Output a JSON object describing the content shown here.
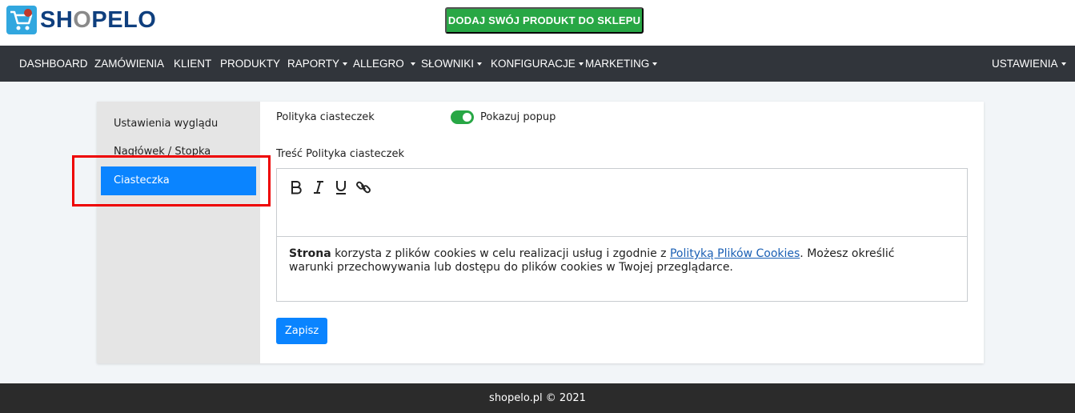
{
  "header": {
    "logo": {
      "prefix": "SH",
      "o": "O",
      "suffix": "PELO"
    },
    "cta_label": "DODAJ SWÓJ PRODUKT DO SKLEPU"
  },
  "nav": {
    "items": [
      {
        "label": "DASHBOARD"
      },
      {
        "label": "ZAMÓWIENIA"
      },
      {
        "label": "KLIENT"
      },
      {
        "label": "PRODUKTY"
      },
      {
        "label": "RAPORTY"
      },
      {
        "label": "ALLEGRO"
      },
      {
        "label": "SŁOWNIKI"
      },
      {
        "label": "KONFIGURACJE"
      },
      {
        "label": "MARKETING"
      }
    ],
    "settings_label": "USTAWIENIA"
  },
  "sidebar": {
    "items": [
      {
        "label": "Ustawienia wyglądu"
      },
      {
        "label": "Nagłówek / Stopka"
      },
      {
        "label": "Ciasteczka"
      }
    ]
  },
  "form": {
    "policy_label": "Polityka ciasteczek",
    "popup_label": "Pokazuj popup",
    "popup_enabled": true,
    "content_label": "Treść Polityka ciasteczek",
    "content": {
      "bold": "Strona",
      "text1": " korzysta z plików cookies w celu realizacji usług i zgodnie z ",
      "link": "Polityką Plików Cookies",
      "text2": ". Możesz określić warunki przechowywania lub dostępu do plików cookies w Twojej przeglądarce."
    },
    "save_label": "Zapisz"
  },
  "footer": {
    "text": "shopelo.pl © 2021"
  },
  "colors": {
    "primary": "#0a84ff",
    "success": "#28a745",
    "nav_bg": "#31353b",
    "highlight": "#e00000"
  },
  "icons": [
    "cart-logo-icon",
    "bold-icon",
    "italic-icon",
    "underline-icon",
    "link-icon",
    "caret-down-icon"
  ]
}
